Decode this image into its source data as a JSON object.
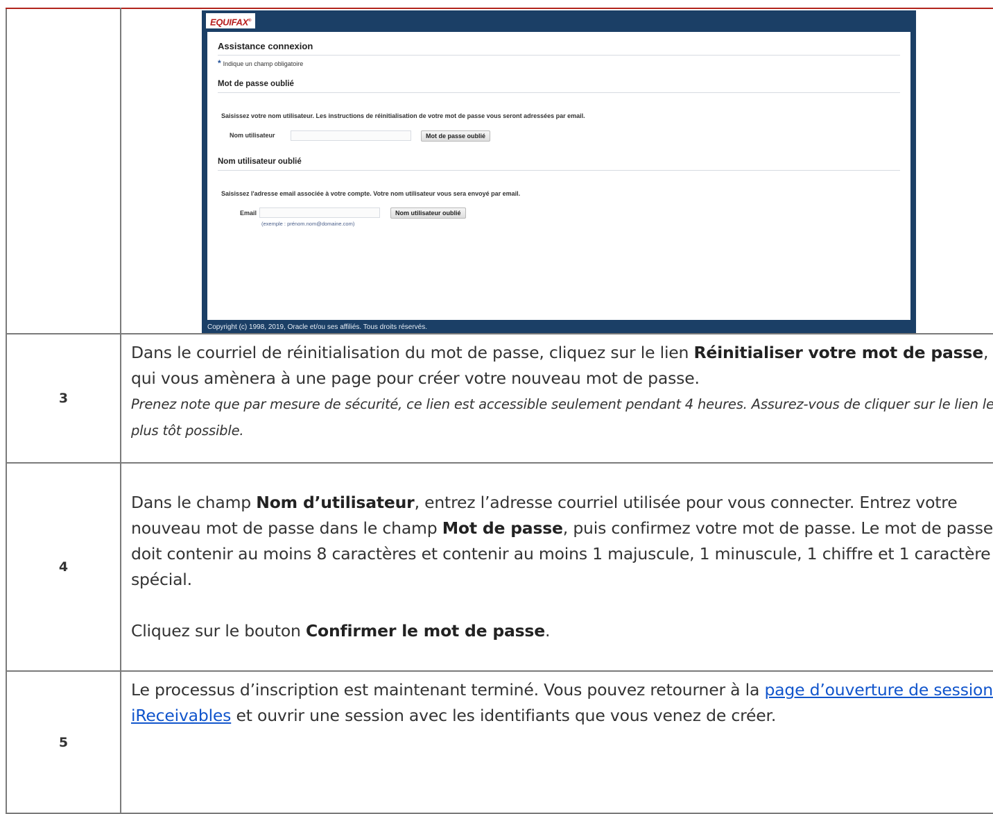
{
  "screenshot": {
    "logo": "EQUIFAX",
    "logo_mark": "®",
    "title": "Assistance connexion",
    "required_star": "*",
    "required_note": "Indique un champ obligatoire",
    "password_section": {
      "heading": "Mot de passe oublié",
      "instructions": "Saisissez votre nom utilisateur. Les instructions de réinitialisation de votre mot de passe vous seront adressées par email.",
      "field_label": "Nom utilisateur",
      "field_value": "",
      "button": "Mot de passe oublié"
    },
    "username_section": {
      "heading": "Nom utilisateur oublié",
      "instructions": "Saisissez l'adresse email associée à votre compte. Votre nom utilisateur vous sera envoyé par email.",
      "field_label": "Email",
      "field_value": "",
      "hint": "(exemple : prénom.nom@domaine.com)",
      "button": "Nom utilisateur oublié"
    },
    "copyright": "Copyright (c) 1998, 2019, Oracle et/ou ses affiliés. Tous droits réservés."
  },
  "steps": [
    {
      "number": "3",
      "p1": "Dans le courriel de réinitialisation du mot de passe, cliquez sur le lien ",
      "b1": "Réinitialiser votre mot de passe",
      "p2": ", qui vous amènera à une page pour créer votre nouveau mot de passe.",
      "note": "Prenez note que par mesure de sécurité, ce lien est accessible seulement pendant 4 heures. Assurez-vous de cliquer sur le lien le plus tôt possible."
    },
    {
      "number": "4",
      "p1": "Dans le champ ",
      "b1": "Nom d’utilisateur",
      "p2": ", entrez l’adresse courriel utilisée pour vous connecter. Entrez votre nouveau mot de passe dans le champ ",
      "b2": "Mot de passe",
      "p3": ", puis confirmez votre mot de passe. Le mot de passe doit contenir au moins 8 caractères et contenir au moins 1 majuscule, 1 minuscule, 1 chiffre et 1 caractère spécial.",
      "p4": "Cliquez sur le bouton ",
      "b3": "Confirmer le mot de passe",
      "p5": "."
    },
    {
      "number": "5",
      "p1": "Le processus d’inscription est maintenant terminé.  Vous pouvez retourner à la ",
      "link": "page d’ouverture de session iReceivables",
      "p2": " et ouvrir une session avec les identifiants que vous venez de créer."
    }
  ],
  "colors": {
    "table_border": "#b1241c",
    "shot_frame": "#1b3f66",
    "logo_red": "#b71c1c",
    "link": "#1155cc"
  }
}
